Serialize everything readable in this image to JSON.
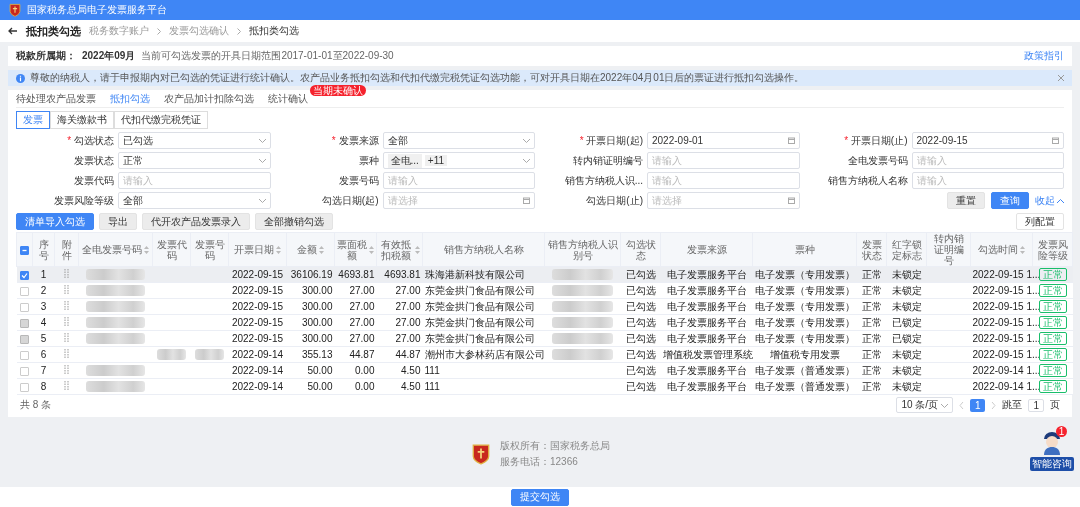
{
  "header": {
    "title": "国家税务总局电子发票服务平台"
  },
  "page": {
    "title": "抵扣类勾选",
    "breadcrumb": [
      "税务数字账户",
      "发票勾选确认",
      "抵扣类勾选"
    ]
  },
  "period": {
    "label": "税款所属期：",
    "value": "2022年09月",
    "note": "当前可勾选发票的开具日期范围2017-01-01至2022-09-30",
    "link": "政策指引"
  },
  "notice": {
    "text": "尊敬的纳税人，请于申报期内对已勾选的凭证进行统计确认。农产品业务抵扣勾选和代扣代缴完税凭证勾选功能，可对开具日期在2022年04月01日后的票证进行抵扣勾选操作。"
  },
  "tabs": [
    {
      "label": "待处理农产品发票",
      "selected": false
    },
    {
      "label": "抵扣勾选",
      "selected": true
    },
    {
      "label": "农产品加计扣除勾选",
      "selected": false
    },
    {
      "label": "统计确认",
      "selected": false,
      "badge": "当期未确认"
    }
  ],
  "subtabs": [
    {
      "label": "发票",
      "selected": true
    },
    {
      "label": "海关缴款书",
      "selected": false
    },
    {
      "label": "代扣代缴完税凭证",
      "selected": false
    }
  ],
  "required_mark": "*",
  "filters": [
    {
      "label": "勾选状态",
      "required": true,
      "kind": "select",
      "value": "已勾选"
    },
    {
      "label": "发票来源",
      "required": true,
      "kind": "select",
      "value": "全部"
    },
    {
      "label": "开票日期(起)",
      "required": true,
      "kind": "date",
      "value": "2022-09-01"
    },
    {
      "label": "开票日期(止)",
      "required": true,
      "kind": "date",
      "value": "2022-09-15"
    },
    {
      "label": "发票状态",
      "required": false,
      "kind": "select",
      "value": "正常"
    },
    {
      "label": "票种",
      "required": false,
      "kind": "tags",
      "tags": [
        "全电...",
        "+11"
      ]
    },
    {
      "label": "转内销证明编号",
      "required": false,
      "kind": "text",
      "placeholder": "请输入"
    },
    {
      "label": "全电发票号码",
      "required": false,
      "kind": "text",
      "placeholder": "请输入"
    },
    {
      "label": "发票代码",
      "required": false,
      "kind": "text",
      "placeholder": "请输入"
    },
    {
      "label": "发票号码",
      "required": false,
      "kind": "text",
      "placeholder": "请输入"
    },
    {
      "label": "销售方纳税人识...",
      "required": false,
      "kind": "text",
      "placeholder": "请输入"
    },
    {
      "label": "销售方纳税人名称",
      "required": false,
      "kind": "text",
      "placeholder": "请输入"
    },
    {
      "label": "发票风险等级",
      "required": false,
      "kind": "select",
      "value": "全部"
    },
    {
      "label": "勾选日期(起)",
      "required": false,
      "kind": "date",
      "placeholder": "请选择"
    },
    {
      "label": "勾选日期(止)",
      "required": false,
      "kind": "date",
      "placeholder": "请选择"
    }
  ],
  "filter_buttons": {
    "reset": "重置",
    "search": "查询",
    "collapse": "收起"
  },
  "actions": [
    {
      "label": "清单导入勾选",
      "primary": true
    },
    {
      "label": "导出",
      "primary": false
    },
    {
      "label": "代开农产品发票录入",
      "primary": false
    },
    {
      "label": "全部撤销勾选",
      "primary": false
    }
  ],
  "column_settings": "列配置",
  "table": {
    "header_checkbox": {
      "indeterminate": true
    },
    "columns": [
      {
        "label": "序号",
        "sortable": false
      },
      {
        "label": "附件",
        "sortable": false,
        "kind": "attachment"
      },
      {
        "label": "全电发票号码",
        "sortable": true
      },
      {
        "label": "发票代码",
        "sortable": false
      },
      {
        "label": "发票号码",
        "sortable": false
      },
      {
        "label": "开票日期",
        "sortable": true
      },
      {
        "label": "金额",
        "sortable": true
      },
      {
        "label": "票面税额",
        "sortable": true
      },
      {
        "label": "有效抵扣税额",
        "sortable": true
      },
      {
        "label": "销售方纳税人名称",
        "sortable": false
      },
      {
        "label": "销售方纳税人识别号",
        "sortable": false
      },
      {
        "label": "勾选状态",
        "sortable": false
      },
      {
        "label": "发票来源",
        "sortable": false
      },
      {
        "label": "票种",
        "sortable": false
      },
      {
        "label": "发票状态",
        "sortable": false
      },
      {
        "label": "红字锁定标志",
        "sortable": false
      },
      {
        "label": "转内销证明编号",
        "sortable": false
      },
      {
        "label": "勾选时间",
        "sortable": true
      },
      {
        "label": "发票风险等级",
        "sortable": false,
        "kind": "tag"
      }
    ],
    "rows": [
      {
        "checked": true,
        "disabled": false,
        "selected": true,
        "cells": [
          "1",
          null,
          {
            "kind": "blurred"
          },
          null,
          null,
          "2022-09-15",
          "36106.19",
          "4693.81",
          "4693.81",
          "珠海港新科技有限公司",
          {
            "kind": "blurred"
          },
          "已勾选",
          "电子发票服务平台",
          "电子发票（专用发票）",
          "正常",
          "未锁定",
          null,
          "2022-09-15 1...",
          "正常"
        ]
      },
      {
        "checked": false,
        "disabled": false,
        "selected": false,
        "cells": [
          "2",
          null,
          {
            "kind": "blurred"
          },
          null,
          null,
          "2022-09-15",
          "300.00",
          "27.00",
          "27.00",
          "东莞金拱门食品有限公司",
          {
            "kind": "blurred"
          },
          "已勾选",
          "电子发票服务平台",
          "电子发票（专用发票）",
          "正常",
          "未锁定",
          null,
          "2022-09-15 1...",
          "正常"
        ]
      },
      {
        "checked": false,
        "disabled": false,
        "selected": false,
        "cells": [
          "3",
          null,
          {
            "kind": "blurred"
          },
          null,
          null,
          "2022-09-15",
          "300.00",
          "27.00",
          "27.00",
          "东莞金拱门食品有限公司",
          {
            "kind": "blurred"
          },
          "已勾选",
          "电子发票服务平台",
          "电子发票（专用发票）",
          "正常",
          "未锁定",
          null,
          "2022-09-15 1...",
          "正常"
        ]
      },
      {
        "checked": false,
        "disabled": true,
        "selected": false,
        "cells": [
          "4",
          null,
          {
            "kind": "blurred"
          },
          null,
          null,
          "2022-09-15",
          "300.00",
          "27.00",
          "27.00",
          "东莞金拱门食品有限公司",
          {
            "kind": "blurred"
          },
          "已勾选",
          "电子发票服务平台",
          "电子发票（专用发票）",
          "正常",
          "已锁定",
          null,
          "2022-09-15 1...",
          "正常"
        ]
      },
      {
        "checked": false,
        "disabled": true,
        "selected": false,
        "cells": [
          "5",
          null,
          {
            "kind": "blurred"
          },
          null,
          null,
          "2022-09-15",
          "300.00",
          "27.00",
          "27.00",
          "东莞金拱门食品有限公司",
          {
            "kind": "blurred"
          },
          "已勾选",
          "电子发票服务平台",
          "电子发票（专用发票）",
          "正常",
          "已锁定",
          null,
          "2022-09-15 1...",
          "正常"
        ]
      },
      {
        "checked": false,
        "disabled": false,
        "selected": false,
        "cells": [
          "6",
          null,
          null,
          {
            "kind": "blurred"
          },
          {
            "kind": "blurred"
          },
          "2022-09-14",
          "355.13",
          "44.87",
          "44.87",
          "潮州市大参林药店有限公司",
          {
            "kind": "blurred"
          },
          "已勾选",
          "增值税发票管理系统",
          "增值税专用发票",
          "正常",
          "未锁定",
          null,
          "2022-09-15 1...",
          "正常"
        ]
      },
      {
        "checked": false,
        "disabled": false,
        "selected": false,
        "cells": [
          "7",
          null,
          {
            "kind": "blurred"
          },
          null,
          null,
          "2022-09-14",
          "50.00",
          "0.00",
          "4.50",
          "111",
          null,
          "已勾选",
          "电子发票服务平台",
          "电子发票（普通发票）",
          "正常",
          "未锁定",
          null,
          "2022-09-14 1...",
          "正常"
        ]
      },
      {
        "checked": false,
        "disabled": false,
        "selected": false,
        "cells": [
          "8",
          null,
          {
            "kind": "blurred"
          },
          null,
          null,
          "2022-09-14",
          "50.00",
          "0.00",
          "4.50",
          "111",
          null,
          "已勾选",
          "电子发票服务平台",
          "电子发票（普通发票）",
          "正常",
          "未锁定",
          null,
          "2022-09-14 1...",
          "正常"
        ]
      }
    ]
  },
  "pagination": {
    "total": "共 8 条",
    "page_size": "10 条/页",
    "pages": [
      {
        "label": "1",
        "selected": true
      }
    ],
    "jump_label": "跳至",
    "jump_value": "1",
    "jump_suffix": "页"
  },
  "footer": {
    "lines": [
      "版权所有：国家税务总局",
      "服务电话：12366"
    ]
  },
  "assistant": {
    "badge": "1",
    "label": "智能咨询"
  },
  "submit": "提交勾选"
}
